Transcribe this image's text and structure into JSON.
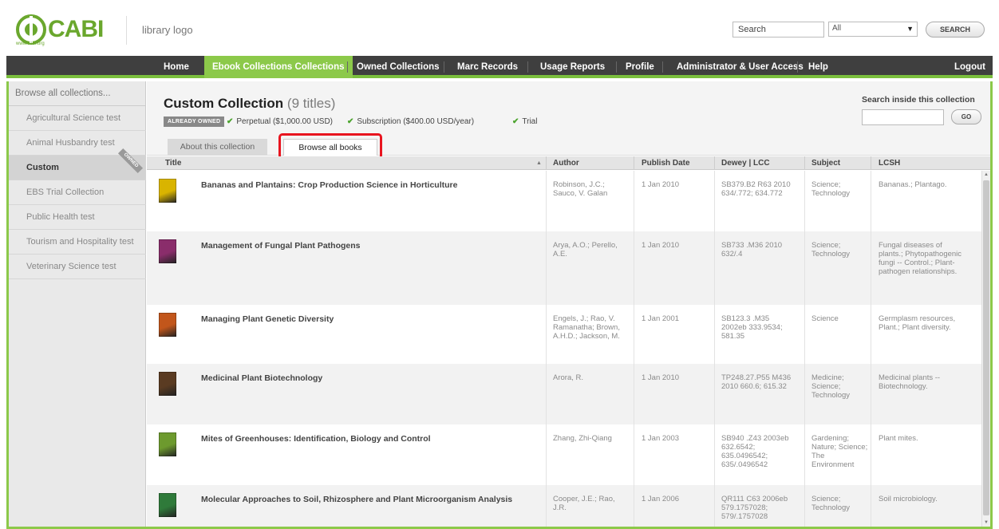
{
  "header": {
    "logo_text": "CABI",
    "logo_url": "www.cabi.org",
    "library_logo": "library logo",
    "search_value": "Search",
    "search_scope": "All",
    "search_button": "SEARCH"
  },
  "nav": {
    "items": [
      {
        "label": "Home"
      },
      {
        "label": "Ebook Collections Collections"
      },
      {
        "label": "Owned Collections"
      },
      {
        "label": "Marc Records"
      },
      {
        "label": "Usage Reports"
      },
      {
        "label": "Profile"
      },
      {
        "label": "Administrator & User Access"
      },
      {
        "label": "Help"
      },
      {
        "label": "Logout"
      }
    ],
    "active_index": 1
  },
  "sidebar": {
    "heading": "Browse all collections...",
    "items": [
      {
        "label": "Agricultural Science test"
      },
      {
        "label": "Animal Husbandry test"
      },
      {
        "label": "Custom",
        "badge": "OWNED"
      },
      {
        "label": "EBS Trial Collection"
      },
      {
        "label": "Public Health test"
      },
      {
        "label": "Tourism and Hospitality test"
      },
      {
        "label": "Veterinary Science test"
      }
    ],
    "active_index": 2
  },
  "collection": {
    "title": "Custom Collection",
    "count": "(9 titles)",
    "owned_badge": "ALREADY OWNED",
    "licenses": [
      {
        "label": "Perpetual ($1,000.00 USD)"
      },
      {
        "label": "Subscription ($400.00 USD/year)"
      },
      {
        "label": "Trial"
      }
    ],
    "search_inside_label": "Search inside this collection",
    "go_button": "GO",
    "tabs": {
      "about": "About this collection",
      "browse": "Browse all books"
    }
  },
  "table": {
    "columns": [
      "Title",
      "Author",
      "Publish Date",
      "Dewey | LCC",
      "Subject",
      "LCSH"
    ],
    "rows": [
      {
        "title": "Bananas and Plantains: Crop Production Science in Horticulture",
        "author": "Robinson, J.C.; Sauco, V. Galan",
        "date": "1 Jan 2010",
        "dewey": "SB379.B2 R63 2010 634/.772; 634.772",
        "subject": "Science; Technology",
        "lcsh": "Bananas.; Plantago.",
        "cover_color": "#d9b400"
      },
      {
        "title": "Management of Fungal Plant Pathogens",
        "author": "Arya, A.O.; Perello, A.E.",
        "date": "1 Jan 2010",
        "dewey": "SB733 .M36 2010 632/.4",
        "subject": "Science; Technology",
        "lcsh": "Fungal diseases of plants.; Phytopathogenic fungi -- Control.; Plant-pathogen relationships.",
        "cover_color": "#8a2d6b"
      },
      {
        "title": "Managing Plant Genetic Diversity",
        "author": "Engels, J.; Rao, V. Ramanatha; Brown, A.H.D.; Jackson, M.",
        "date": "1 Jan 2001",
        "dewey": "SB123.3 .M35 2002eb 333.9534; 581.35",
        "subject": "Science",
        "lcsh": "Germplasm resources, Plant.; Plant diversity.",
        "cover_color": "#c2561b"
      },
      {
        "title": "Medicinal Plant Biotechnology",
        "author": "Arora, R.",
        "date": "1 Jan 2010",
        "dewey": "TP248.27.P55 M436 2010 660.6; 615.32",
        "subject": "Medicine; Science; Technology",
        "lcsh": "Medicinal plants -- Biotechnology.",
        "cover_color": "#5a3b22"
      },
      {
        "title": "Mites of Greenhouses: Identification, Biology and Control",
        "author": "Zhang, Zhi-Qiang",
        "date": "1 Jan 2003",
        "dewey": "SB940 .Z43 2003eb 632.6542; 635.0496542; 635/.0496542",
        "subject": "Gardening; Nature; Science; The Environment",
        "lcsh": "Plant mites.",
        "cover_color": "#6d9a2e"
      },
      {
        "title": "Molecular Approaches to Soil, Rhizosphere and Plant Microorganism Analysis",
        "author": "Cooper, J.E.; Rao, J.R.",
        "date": "1 Jan 2006",
        "dewey": "QR111 C63 2006eb 579.1757028; 579/.1757028",
        "subject": "Science; Technology",
        "lcsh": "Soil microbiology.",
        "cover_color": "#2f7a3a"
      }
    ]
  }
}
